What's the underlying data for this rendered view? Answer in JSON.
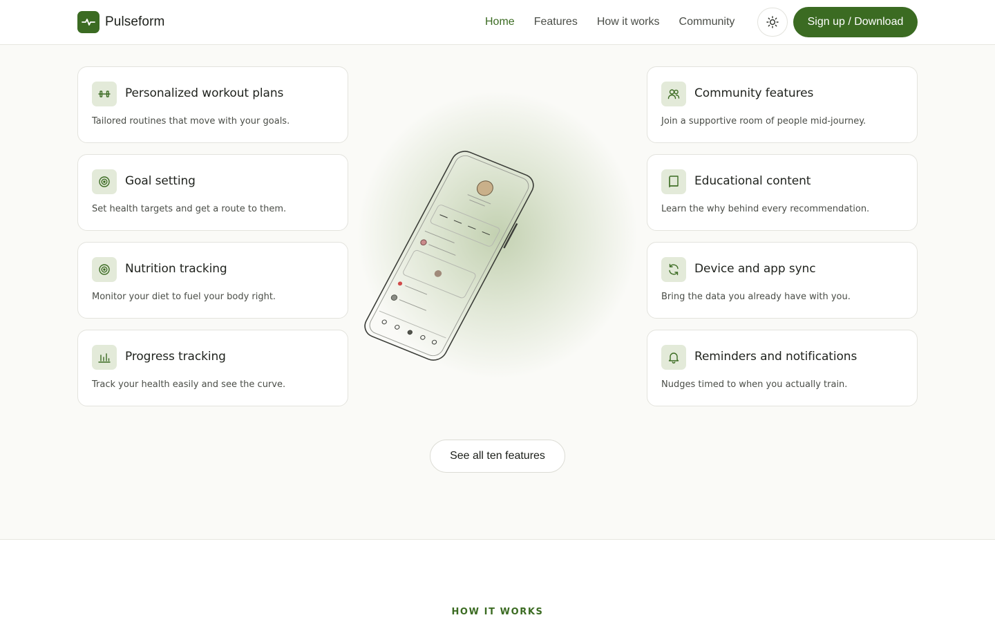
{
  "header": {
    "brand": "Pulseform",
    "nav": [
      {
        "label": "Home",
        "active": true
      },
      {
        "label": "Features",
        "active": false
      },
      {
        "label": "How it works",
        "active": false
      },
      {
        "label": "Community",
        "active": false
      }
    ],
    "theme_toggle_icon": "sun-icon",
    "cta_label": "Sign up / Download"
  },
  "features": {
    "left": [
      {
        "title": "Personalized workout plans",
        "desc": "Tailored routines that move with your goals.",
        "icon": "dumbbell-icon"
      },
      {
        "title": "Goal setting",
        "desc": "Set health targets and get a route to them.",
        "icon": "target-icon"
      },
      {
        "title": "Nutrition tracking",
        "desc": "Monitor your diet to fuel your body right.",
        "icon": "target-icon"
      },
      {
        "title": "Progress tracking",
        "desc": "Track your health easily and see the curve.",
        "icon": "bar-chart-icon"
      }
    ],
    "right": [
      {
        "title": "Community features",
        "desc": "Join a supportive room of people mid-journey.",
        "icon": "users-icon"
      },
      {
        "title": "Educational content",
        "desc": "Learn the why behind every recommendation.",
        "icon": "book-icon"
      },
      {
        "title": "Device and app sync",
        "desc": "Bring the data you already have with you.",
        "icon": "sync-icon"
      },
      {
        "title": "Reminders and notifications",
        "desc": "Nudges timed to when you actually train.",
        "icon": "bell-icon"
      }
    ],
    "see_all_label": "See all ten features"
  },
  "next_section": {
    "eyebrow": "HOW IT WORKS"
  },
  "colors": {
    "accent": "#3b6b22",
    "icon_bg": "#e3ead9",
    "page_bg": "#fafaf7"
  }
}
